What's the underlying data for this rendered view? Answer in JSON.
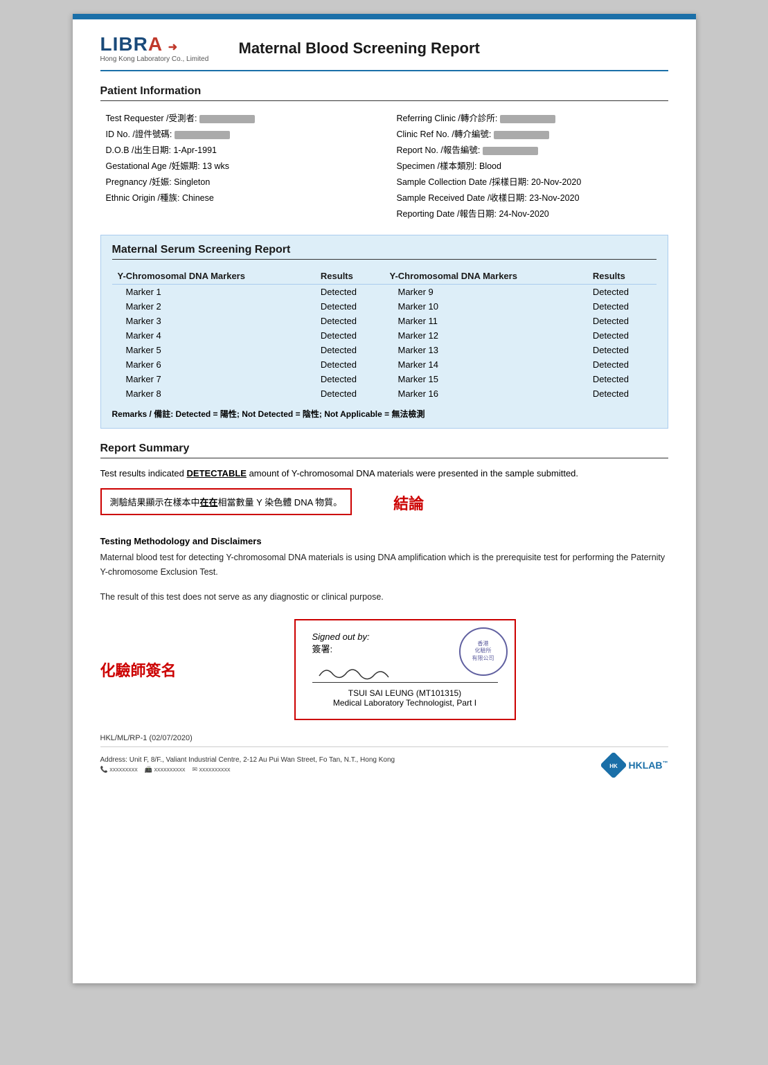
{
  "header": {
    "logo_text": "LIBRA",
    "logo_sub": "Hong Kong Laboratory Co., Limited",
    "report_title": "Maternal Blood Screening Report"
  },
  "patient_info": {
    "section_label": "Patient Information",
    "fields_left": [
      {
        "label": "Test Requester /受測者:",
        "value": "REDACTED"
      },
      {
        "label": "ID No. /證件號碼:",
        "value": "REDACTED"
      },
      {
        "label": "D.O.B /出生日期:",
        "value": "1-Apr-1991"
      },
      {
        "label": "Gestational Age /妊娠期:",
        "value": "13 wks"
      },
      {
        "label": "Pregnancy /妊娠:",
        "value": "Singleton"
      },
      {
        "label": "Ethnic Origin /種族:",
        "value": "Chinese"
      }
    ],
    "fields_right": [
      {
        "label": "Referring Clinic /轉介診所:",
        "value": "REDACTED"
      },
      {
        "label": "Clinic Ref No. /轉介編號:",
        "value": "REDACTED"
      },
      {
        "label": "Report No. /報告編號:",
        "value": "REDACTED"
      },
      {
        "label": "Specimen /樣本類別:",
        "value": "Blood"
      },
      {
        "label": "Sample Collection Date /採樣日期:",
        "value": "20-Nov-2020"
      },
      {
        "label": "Sample Received Date /收樣日期:",
        "value": "23-Nov-2020"
      },
      {
        "label": "Reporting Date /報告日期:",
        "value": "24-Nov-2020"
      }
    ]
  },
  "screening": {
    "section_label": "Maternal Serum Screening Report",
    "col1_header": "Y-Chromosomal DNA Markers",
    "col2_header": "Results",
    "col3_header": "Y-Chromosomal DNA Markers",
    "col4_header": "Results",
    "markers_left": [
      {
        "name": "Marker 1",
        "result": "Detected"
      },
      {
        "name": "Marker 2",
        "result": "Detected"
      },
      {
        "name": "Marker 3",
        "result": "Detected"
      },
      {
        "name": "Marker 4",
        "result": "Detected"
      },
      {
        "name": "Marker 5",
        "result": "Detected"
      },
      {
        "name": "Marker 6",
        "result": "Detected"
      },
      {
        "name": "Marker 7",
        "result": "Detected"
      },
      {
        "name": "Marker 8",
        "result": "Detected"
      }
    ],
    "markers_right": [
      {
        "name": "Marker 9",
        "result": "Detected"
      },
      {
        "name": "Marker 10",
        "result": "Detected"
      },
      {
        "name": "Marker 11",
        "result": "Detected"
      },
      {
        "name": "Marker 12",
        "result": "Detected"
      },
      {
        "name": "Marker 13",
        "result": "Detected"
      },
      {
        "name": "Marker 14",
        "result": "Detected"
      },
      {
        "name": "Marker 15",
        "result": "Detected"
      },
      {
        "name": "Marker 16",
        "result": "Detected"
      }
    ],
    "remarks": "Remarks / 備註: Detected = 陽性; Not Detected = 陰性; Not Applicable = 無法檢測"
  },
  "report_summary": {
    "section_label": "Report Summary",
    "text1": "Test results indicated ",
    "detectable": "DETECTABLE",
    "text2": " amount of Y-chromosomal DNA materials were presented in the sample submitted.",
    "chinese_line": "測驗結果顯示在樣本中在在相當數量 Y 染色體 DNA 物質。",
    "conclusion_label": "結論"
  },
  "methodology": {
    "title": "Testing Methodology and Disclaimers",
    "text1": "Maternal blood test for detecting Y-chromosomal DNA materials is using DNA amplification which is the prerequisite test for performing the Paternity Y-chromosome Exclusion Test.",
    "text2": "The result of this test does not serve as any diagnostic or clinical purpose."
  },
  "signature": {
    "chemist_label": "化驗師簽名",
    "signed_out_by": "Signed out by:",
    "signed_chinese": "簽署:",
    "name": "TSUI SAI LEUNG (MT101315)",
    "title": "Medical Laboratory Technologist, Part I",
    "stamp_text": "香港\n化驗所\n有限公司"
  },
  "footer": {
    "ref": "HKL/ML/RP-1 (02/07/2020)",
    "address": "Address: Unit F, 8/F., Valiant Industrial Centre, 2-12 Au Pui Wan Street, Fo Tan, N.T., Hong Kong",
    "contacts": "電話 xxxxxxxxx   傳真 xxxxxxxxxx   電郵 xxxxxxxxxx",
    "hklab": "HKLAB"
  }
}
